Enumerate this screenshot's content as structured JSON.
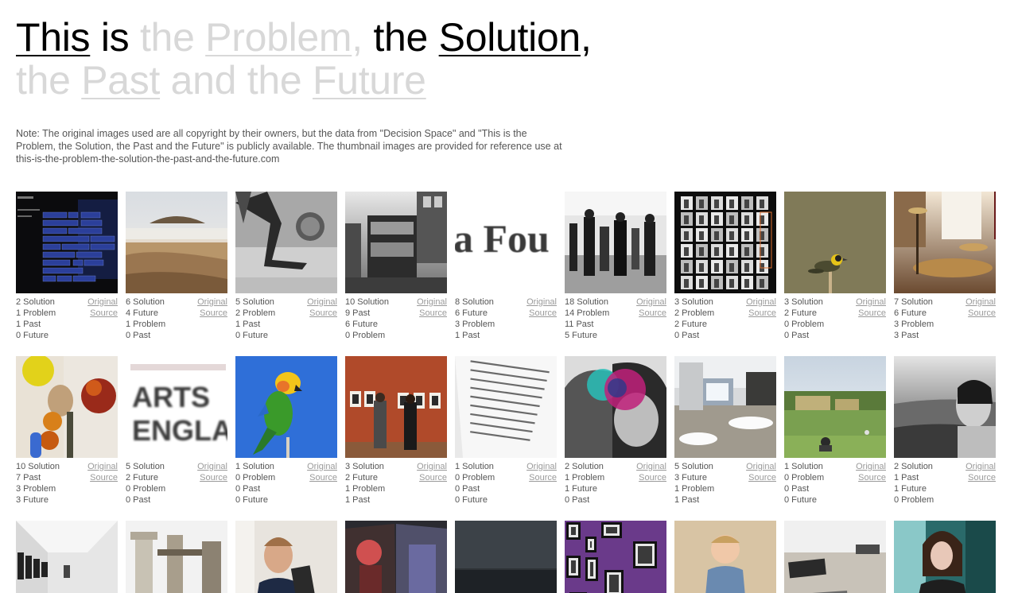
{
  "title": {
    "w1": "This",
    "w2": " is ",
    "w3": "the ",
    "w4": "Problem",
    "w5": ", ",
    "w6": "the ",
    "w7": "Solution",
    "w8": ",",
    "w9": "the ",
    "w10": "Past",
    "w11": " and the ",
    "w12": "Future"
  },
  "note": "Note: The original images used are all copyright by their owners, but the data from \"Decision Space\" and \"This is the Problem, the Solution, the Past and the Future\" is publicly available. The thumbnail images are provided for reference use at this-is-the-problem-the-solution-the-past-and-the-future.com",
  "link_labels": {
    "original": "Original",
    "source": "Source"
  },
  "rows": [
    [
      {
        "image": "dark-tag-cloud-screen",
        "stats": [
          "2 Solution",
          "1 Problem",
          "1 Past",
          "0 Future"
        ]
      },
      {
        "image": "misty-mountain-landscape",
        "stats": [
          "6 Solution",
          "4 Future",
          "1 Problem",
          "0 Past"
        ]
      },
      {
        "image": "bw-leg-kicking-ball",
        "stats": [
          "5 Solution",
          "2 Problem",
          "1 Past",
          "0 Future"
        ]
      },
      {
        "image": "bw-double-decker-bus",
        "stats": [
          "10 Solution",
          "9 Past",
          "6 Future",
          "0 Problem"
        ]
      },
      {
        "image": "blurred-text-a-fou",
        "text": "a Fou",
        "stats": [
          "8 Solution",
          "6 Future",
          "3 Problem",
          "1 Past"
        ]
      },
      {
        "image": "bw-gallery-crowd",
        "stats": [
          "18 Solution",
          "14 Problem",
          "11 Past",
          "5 Future"
        ]
      },
      {
        "image": "contact-sheet-photos",
        "stats": [
          "3 Solution",
          "2 Problem",
          "2 Future",
          "0 Past"
        ]
      },
      {
        "image": "bird-on-stick",
        "stats": [
          "3 Solution",
          "2 Future",
          "0 Problem",
          "0 Past"
        ]
      },
      {
        "image": "drum-kit-in-room",
        "stats": [
          "7 Solution",
          "6 Future",
          "3 Problem",
          "3 Past"
        ]
      }
    ],
    [
      {
        "image": "fruit-still-life",
        "stats": [
          "10 Solution",
          "7 Past",
          "3 Problem",
          "3 Future"
        ]
      },
      {
        "image": "arts-council-england-sign",
        "text": "ARTS ENGLA",
        "stats": [
          "5 Solution",
          "2 Future",
          "0 Problem",
          "0 Past"
        ]
      },
      {
        "image": "parrot-on-blue",
        "stats": [
          "1 Solution",
          "0 Problem",
          "0 Past",
          "0 Future"
        ]
      },
      {
        "image": "gallery-red-wall-visitors",
        "stats": [
          "3 Solution",
          "2 Future",
          "1 Problem",
          "1 Past"
        ]
      },
      {
        "image": "open-book-pages",
        "stats": [
          "1 Solution",
          "0 Problem",
          "0 Past",
          "0 Future"
        ]
      },
      {
        "image": "kissing-couple-collage",
        "stats": [
          "2 Solution",
          "1 Problem",
          "1 Future",
          "0 Past"
        ]
      },
      {
        "image": "conference-room",
        "stats": [
          "5 Solution",
          "3 Future",
          "1 Problem",
          "1 Past"
        ]
      },
      {
        "image": "park-with-building",
        "stats": [
          "1 Solution",
          "0 Problem",
          "0 Past",
          "0 Future"
        ]
      },
      {
        "image": "bw-woman-by-sea",
        "stats": [
          "2 Solution",
          "1 Past",
          "1 Future",
          "0 Problem"
        ]
      }
    ],
    [
      {
        "image": "white-gallery-hall"
      },
      {
        "image": "ruined-stone-columns"
      },
      {
        "image": "man-holding-object"
      },
      {
        "image": "magazine-spread"
      },
      {
        "image": "dark-sea-horizon"
      },
      {
        "image": "framed-photos-purple-wall"
      },
      {
        "image": "toddler-on-floor"
      },
      {
        "image": "books-on-table"
      },
      {
        "image": "woman-in-teal-room"
      }
    ]
  ]
}
